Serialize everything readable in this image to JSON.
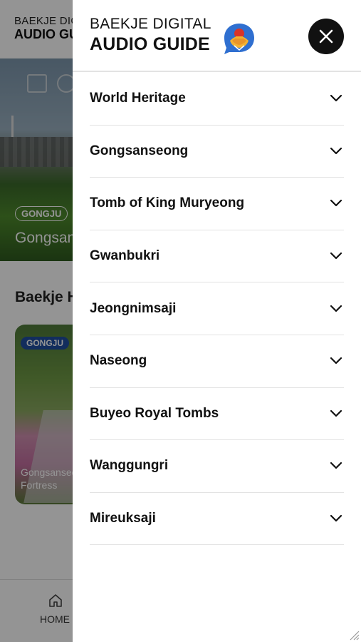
{
  "background": {
    "brand_top": "BAEKJE DIGITAL",
    "brand_bottom": "AUDIO GUIDE",
    "hero_tag": "GONGJU",
    "hero_title": "Gongsanseong",
    "section_title": "Baekje Heritage",
    "card": {
      "tag": "GONGJU",
      "title_line1": "Gongsanseong",
      "title_line2": "Fortress"
    },
    "bottom_nav": {
      "home_label": "HOME"
    }
  },
  "drawer": {
    "logo_line1": "BAEKJE DIGITAL",
    "logo_line2": "AUDIO GUIDE",
    "close_icon": "close-icon",
    "menu_items": [
      {
        "label": "World Heritage"
      },
      {
        "label": "Gongsanseong"
      },
      {
        "label": "Tomb of King Muryeong"
      },
      {
        "label": "Gwanbukri"
      },
      {
        "label": "Jeongnimsaji"
      },
      {
        "label": "Naseong"
      },
      {
        "label": "Buyeo Royal Tombs"
      },
      {
        "label": "Wanggungri"
      },
      {
        "label": "Mireuksaji"
      }
    ],
    "chevron_icon": "chevron-down-icon"
  },
  "colors": {
    "overlay": "rgba(0,0,0,0.42)",
    "text_primary": "#111111",
    "divider": "#e3e3e3",
    "tag_blue": "#1f4fa0",
    "logo_blue": "#2f6fd0",
    "logo_red": "#d8342a",
    "logo_gold": "#f2b233"
  }
}
